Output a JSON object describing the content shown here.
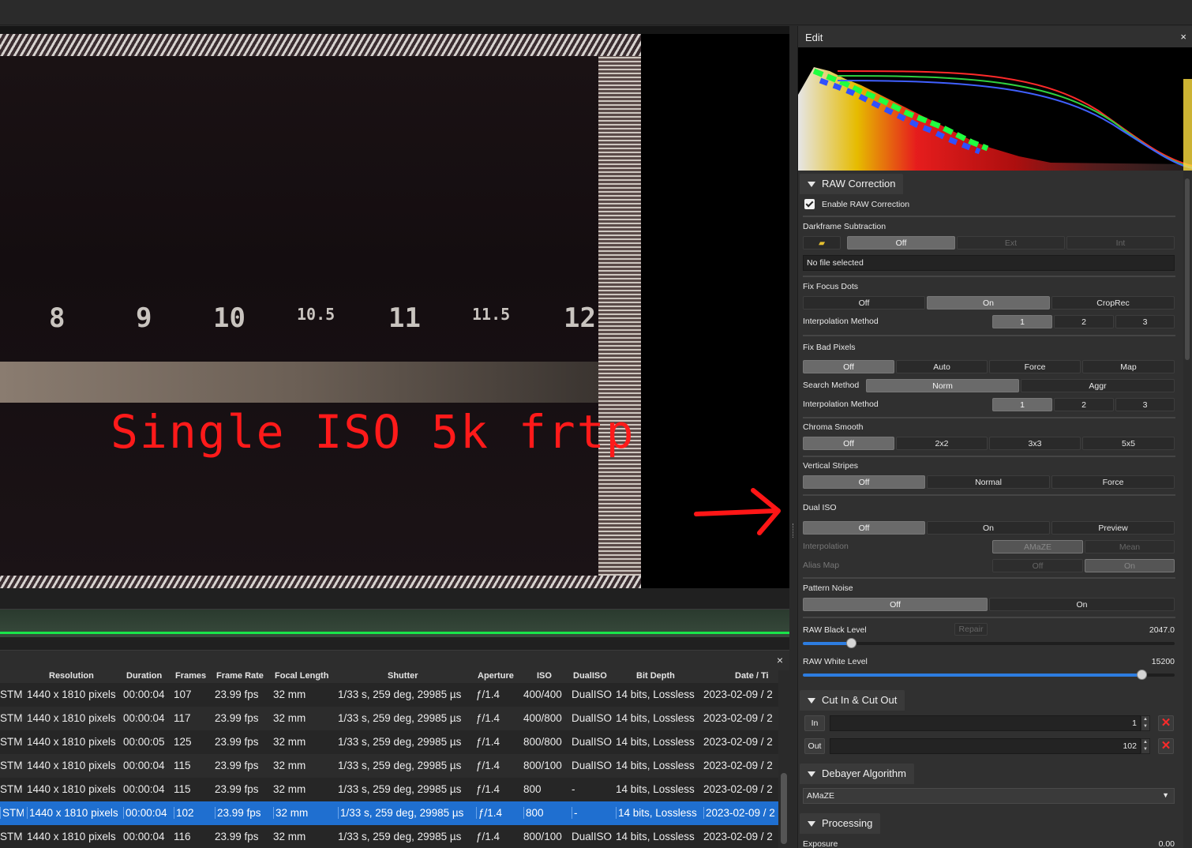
{
  "viewer": {
    "ruler_numbers": [
      "8",
      "9",
      "10",
      "10.5",
      "11",
      "11.5",
      "12"
    ],
    "overlay_text": "Single ISO 5k frtp"
  },
  "clips": {
    "columns": [
      "Resolution",
      "Duration",
      "Frames",
      "Frame Rate",
      "Focal Length",
      "Shutter",
      "Aperture",
      "ISO",
      "DualISO",
      "Bit Depth",
      "Date / Ti"
    ],
    "rows": [
      {
        "prefix": "STM",
        "resolution": "1440 x 1810 pixels",
        "duration": "00:00:04",
        "frames": "107",
        "fps": "23.99 fps",
        "focal": "32 mm",
        "shutter": "1/33 s,  259 deg,  29985 µs",
        "aperture": "ƒ/1.4",
        "iso": "400/400",
        "dualiso": "DualISO",
        "bitdepth": "14 bits,  Lossless",
        "date": "2023-02-09 / 2"
      },
      {
        "prefix": "STM",
        "resolution": "1440 x 1810 pixels",
        "duration": "00:00:04",
        "frames": "117",
        "fps": "23.99 fps",
        "focal": "32 mm",
        "shutter": "1/33 s,  259 deg,  29985 µs",
        "aperture": "ƒ/1.4",
        "iso": "400/800",
        "dualiso": "DualISO",
        "bitdepth": "14 bits,  Lossless",
        "date": "2023-02-09 / 2"
      },
      {
        "prefix": "STM",
        "resolution": "1440 x 1810 pixels",
        "duration": "00:00:05",
        "frames": "125",
        "fps": "23.99 fps",
        "focal": "32 mm",
        "shutter": "1/33 s,  259 deg,  29985 µs",
        "aperture": "ƒ/1.4",
        "iso": "800/800",
        "dualiso": "DualISO",
        "bitdepth": "14 bits,  Lossless",
        "date": "2023-02-09 / 2"
      },
      {
        "prefix": "STM",
        "resolution": "1440 x 1810 pixels",
        "duration": "00:00:04",
        "frames": "115",
        "fps": "23.99 fps",
        "focal": "32 mm",
        "shutter": "1/33 s,  259 deg,  29985 µs",
        "aperture": "ƒ/1.4",
        "iso": "800/100",
        "dualiso": "DualISO",
        "bitdepth": "14 bits,  Lossless",
        "date": "2023-02-09 / 2"
      },
      {
        "prefix": "STM",
        "resolution": "1440 x 1810 pixels",
        "duration": "00:00:04",
        "frames": "115",
        "fps": "23.99 fps",
        "focal": "32 mm",
        "shutter": "1/33 s,  259 deg,  29985 µs",
        "aperture": "ƒ/1.4",
        "iso": "800",
        "dualiso": "-",
        "bitdepth": "14 bits,  Lossless",
        "date": "2023-02-09 / 2"
      },
      {
        "prefix": "STM",
        "resolution": "1440 x 1810 pixels",
        "duration": "00:00:04",
        "frames": "102",
        "fps": "23.99 fps",
        "focal": "32 mm",
        "shutter": "1/33 s,  259 deg,  29985 µs",
        "aperture": "ƒ/1.4",
        "iso": "800",
        "dualiso": "-",
        "bitdepth": "14 bits,  Lossless",
        "date": "2023-02-09 / 2",
        "selected": true
      },
      {
        "prefix": "STM",
        "resolution": "1440 x 1810 pixels",
        "duration": "00:00:04",
        "frames": "116",
        "fps": "23.99 fps",
        "focal": "32 mm",
        "shutter": "1/33 s,  259 deg,  29985 µs",
        "aperture": "ƒ/1.4",
        "iso": "800/100",
        "dualiso": "DualISO",
        "bitdepth": "14 bits,  Lossless",
        "date": "2023-02-09 / 2"
      }
    ]
  },
  "edit": {
    "title": "Edit",
    "close": "×",
    "raw_correction": {
      "title": "RAW Correction",
      "enable_label": "Enable RAW Correction",
      "darkframe": {
        "label": "Darkframe Subtraction",
        "options": [
          "Off",
          "Ext",
          "Int"
        ],
        "file": "No file selected"
      },
      "focus_dots": {
        "label": "Fix Focus Dots",
        "options": [
          "Off",
          "On",
          "CropRec"
        ],
        "interp_label": "Interpolation Method",
        "interp_options": [
          "1",
          "2",
          "3"
        ]
      },
      "bad_pixels": {
        "label": "Fix Bad Pixels",
        "options": [
          "Off",
          "Auto",
          "Force",
          "Map"
        ],
        "search_label": "Search Method",
        "search_options": [
          "Norm",
          "Aggr"
        ],
        "interp_label": "Interpolation Method",
        "interp_options": [
          "1",
          "2",
          "3"
        ]
      },
      "chroma": {
        "label": "Chroma Smooth",
        "options": [
          "Off",
          "2x2",
          "3x3",
          "5x5"
        ]
      },
      "stripes": {
        "label": "Vertical Stripes",
        "options": [
          "Off",
          "Normal",
          "Force"
        ]
      },
      "dual_iso": {
        "label": "Dual ISO",
        "options": [
          "Off",
          "On",
          "Preview"
        ],
        "interp_label": "Interpolation",
        "interp_options": [
          "AMaZE",
          "Mean"
        ],
        "alias_label": "Alias Map",
        "alias_options": [
          "Off",
          "On"
        ]
      },
      "pattern": {
        "label": "Pattern Noise",
        "options": [
          "Off",
          "On"
        ]
      },
      "black_level": {
        "label": "RAW Black Level",
        "repair": "Repair",
        "value": "2047.0",
        "fraction": 0.13
      },
      "white_level": {
        "label": "RAW White Level",
        "value": "15200",
        "fraction": 0.91
      }
    },
    "cut": {
      "title": "Cut In & Cut Out",
      "in_label": "In",
      "in_value": "1",
      "out_label": "Out",
      "out_value": "102",
      "clear": "✕",
      "spin_up": "▲",
      "spin_down": "▼"
    },
    "debayer": {
      "title": "Debayer Algorithm",
      "value": "AMaZE"
    },
    "processing": {
      "title": "Processing",
      "exposure_label": "Exposure",
      "exposure_value": "0.00"
    }
  },
  "list_close": "×"
}
